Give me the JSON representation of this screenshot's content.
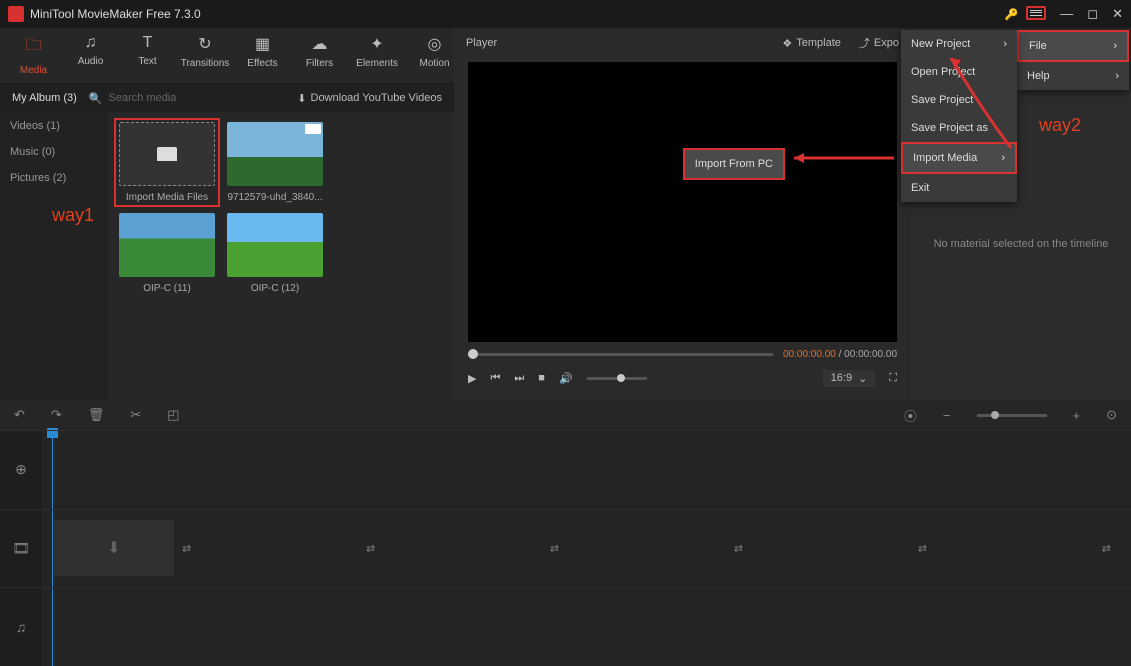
{
  "app": {
    "title": "MiniTool MovieMaker Free 7.3.0"
  },
  "tabs": {
    "media": "Media",
    "audio": "Audio",
    "text": "Text",
    "transitions": "Transitions",
    "effects": "Effects",
    "filters": "Filters",
    "elements": "Elements",
    "motion": "Motion"
  },
  "subbar": {
    "album": "My Album (3)",
    "search_placeholder": "Search media",
    "download": "Download YouTube Videos"
  },
  "sidebar": {
    "videos": "Videos (1)",
    "music": "Music (0)",
    "pictures": "Pictures (2)"
  },
  "media_items": {
    "import": "Import Media Files",
    "v1": "9712579-uhd_3840...",
    "p1": "OIP-C (11)",
    "p2": "OIP-C (12)"
  },
  "player": {
    "title": "Player",
    "template": "Template",
    "export": "Expo",
    "tc_current": "00:00:00.00",
    "tc_total": "00:00:00.00",
    "ratio": "16:9"
  },
  "right": {
    "msg": "No material selected on the timeline"
  },
  "topmenu": {
    "file": "File",
    "help": "Help"
  },
  "filemenu": {
    "new": "New Project",
    "open": "Open Project",
    "save": "Save Project",
    "saveas": "Save Project as",
    "import": "Import Media",
    "exit": "Exit"
  },
  "importpc": "Import From PC",
  "ann": {
    "way1": "way1",
    "way2": "way2"
  }
}
